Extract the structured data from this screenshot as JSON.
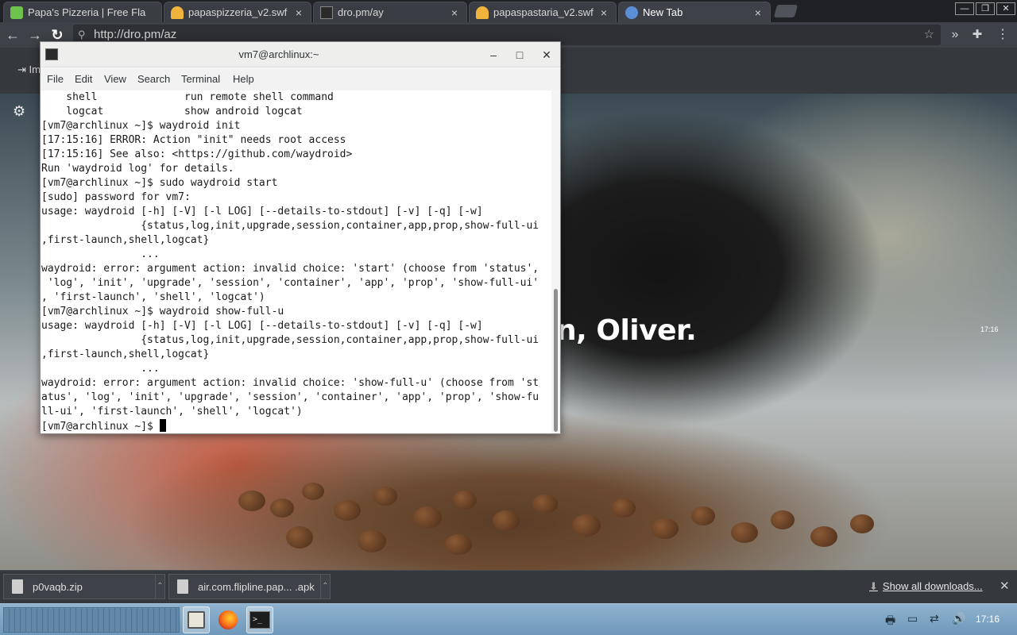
{
  "browser": {
    "tabs": [
      {
        "title": "Papa's Pizzeria | Free Fla",
        "close": "×",
        "favicon_color": "#6cc24a"
      },
      {
        "title": "papaspizzeria_v2.swf",
        "close": "×",
        "favicon_color": "#f0b43c"
      },
      {
        "title": "dro.pm/ay",
        "close": "×",
        "favicon_color": "#2b2b2b"
      },
      {
        "title": "papaspastaria_v2.swf",
        "close": "×",
        "favicon_color": "#f0b43c"
      },
      {
        "title": "New Tab",
        "close": "×",
        "favicon_color": "#5b8fd6"
      }
    ],
    "window_controls": {
      "minimize": "—",
      "restore": "❐",
      "close": "✕"
    },
    "toolbar": {
      "back": "←",
      "forward": "→",
      "reload": "↻",
      "url": "http://dro.pm/az",
      "bookmark_star": "☆",
      "overflow": "»",
      "extensions": "✚",
      "menu": "⋮"
    },
    "bookmark_import_label": "Im"
  },
  "page": {
    "greeting": "n, Oliver.",
    "clock_time": "17:16",
    "settings_icon": "⚙"
  },
  "terminal": {
    "title": "vm7@archlinux:~",
    "controls": {
      "minimize": "–",
      "maximize": "□",
      "close": "✕"
    },
    "menu": [
      "File",
      "Edit",
      "View",
      "Search",
      "Terminal",
      "Help"
    ],
    "lines": [
      "    shell              run remote shell command",
      "    logcat             show android logcat",
      "[vm7@archlinux ~]$ waydroid init",
      "[17:15:16] ERROR: Action \"init\" needs root access",
      "[17:15:16] See also: <https://github.com/waydroid>",
      "Run 'waydroid log' for details.",
      "[vm7@archlinux ~]$ sudo waydroid start",
      "[sudo] password for vm7:",
      "usage: waydroid [-h] [-V] [-l LOG] [--details-to-stdout] [-v] [-q] [-w]",
      "                {status,log,init,upgrade,session,container,app,prop,show-full-ui",
      ",first-launch,shell,logcat}",
      "                ...",
      "waydroid: error: argument action: invalid choice: 'start' (choose from 'status',",
      " 'log', 'init', 'upgrade', 'session', 'container', 'app', 'prop', 'show-full-ui'",
      ", 'first-launch', 'shell', 'logcat')",
      "[vm7@archlinux ~]$ waydroid show-full-u",
      "usage: waydroid [-h] [-V] [-l LOG] [--details-to-stdout] [-v] [-q] [-w]",
      "                {status,log,init,upgrade,session,container,app,prop,show-full-ui",
      ",first-launch,shell,logcat}",
      "                ...",
      "waydroid: error: argument action: invalid choice: 'show-full-u' (choose from 'st",
      "atus', 'log', 'init', 'upgrade', 'session', 'container', 'app', 'prop', 'show-fu",
      "ll-ui', 'first-launch', 'shell', 'logcat')"
    ],
    "prompt": "[vm7@archlinux ~]$ "
  },
  "downloads": {
    "items": [
      {
        "name": "p0vaqb.zip"
      },
      {
        "name": "air.com.flipline.pap... .apk"
      }
    ],
    "show_all": "Show all downloads...",
    "close": "✕"
  },
  "taskbar": {
    "clock": "17:16",
    "tray_icons": [
      "printer-icon",
      "display-icon",
      "network-icon",
      "volume-icon"
    ]
  }
}
